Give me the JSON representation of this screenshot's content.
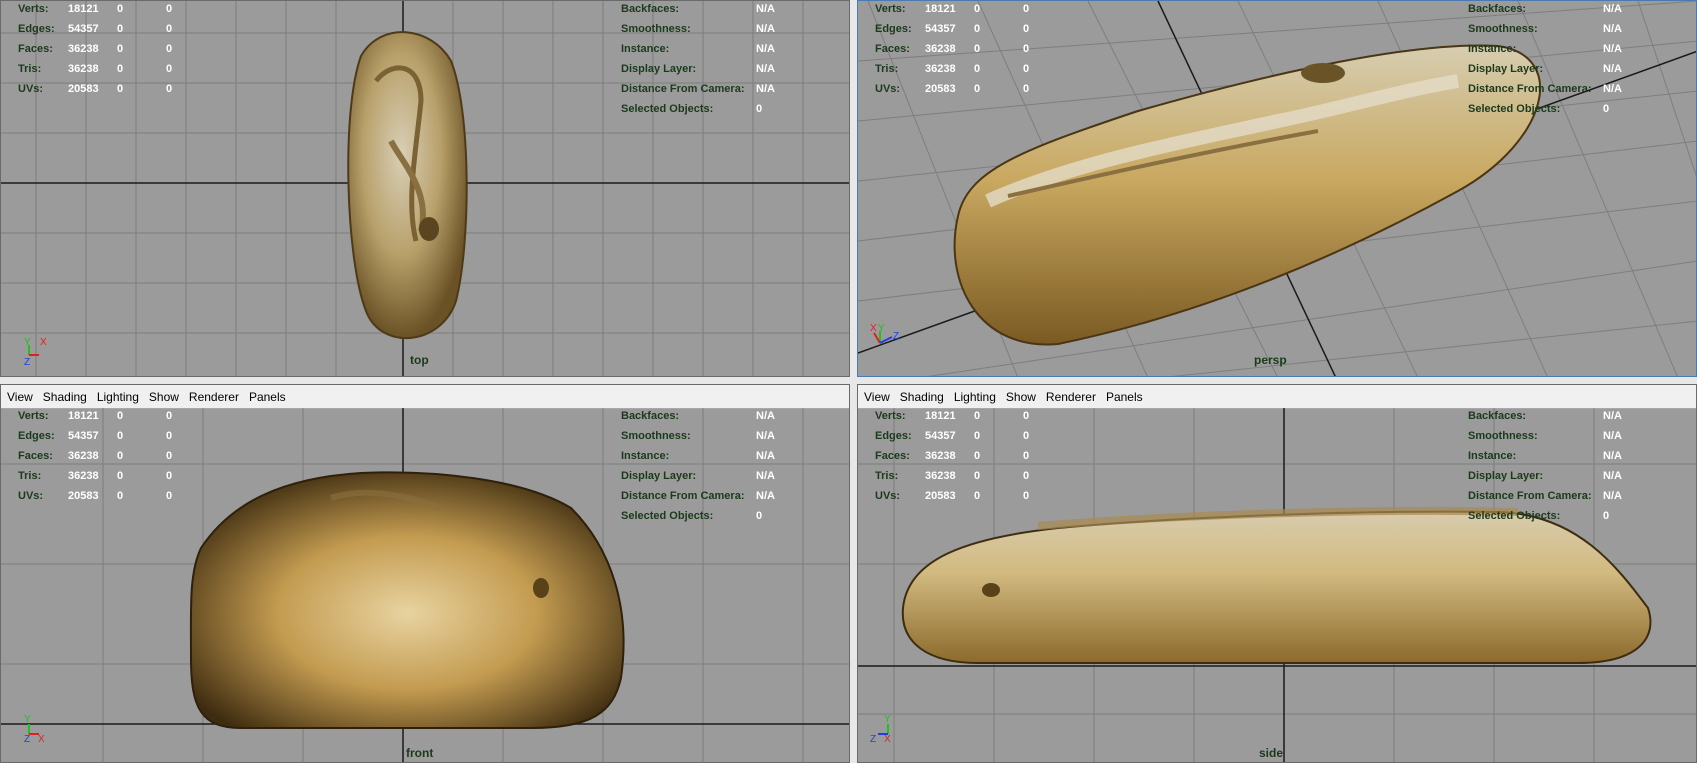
{
  "menu": [
    "View",
    "Shading",
    "Lighting",
    "Show",
    "Renderer",
    "Panels"
  ],
  "stats": {
    "labels": [
      "Verts:",
      "Edges:",
      "Faces:",
      "Tris:",
      "UVs:"
    ],
    "values": [
      [
        "18121",
        "0",
        "0"
      ],
      [
        "54357",
        "0",
        "0"
      ],
      [
        "36238",
        "0",
        "0"
      ],
      [
        "36238",
        "0",
        "0"
      ],
      [
        "20583",
        "0",
        "0"
      ]
    ]
  },
  "info": {
    "labels": [
      "Backfaces:",
      "Smoothness:",
      "Instance:",
      "Display Layer:",
      "Distance From Camera:",
      "Selected Objects:"
    ],
    "values": [
      "N/A",
      "N/A",
      "N/A",
      "N/A",
      "N/A",
      "0"
    ]
  },
  "cameras": {
    "top": "top",
    "persp": "persp",
    "front": "front",
    "side": "side"
  },
  "axes": {
    "y": "Y",
    "x": "X",
    "z": "Z"
  },
  "colors": {
    "viewport_bg": "#9b9b9b",
    "grid": "#7e7e7e",
    "grid_axis": "#1a1a1a",
    "label_green": "#1b3a1b",
    "value_white": "#ffffff",
    "axis_x": "#e02020",
    "axis_y": "#20c020",
    "axis_z": "#2040e0"
  }
}
